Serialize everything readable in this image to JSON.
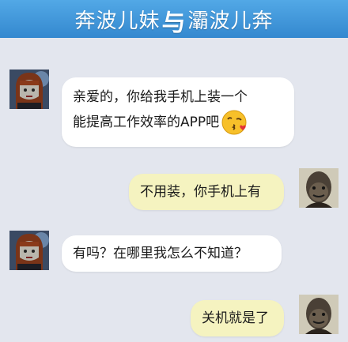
{
  "header": {
    "title_left": "奔波儿妹",
    "title_sep": "与",
    "title_right": "灞波儿奔"
  },
  "messages": [
    {
      "side": "left",
      "sender": "奔波儿妹",
      "lines": [
        "亲爱的，你给我手机上装一个",
        "能提高工作效率的APP吧"
      ],
      "emoji": "kissing-face-icon"
    },
    {
      "side": "right",
      "sender": "灞波儿奔",
      "lines": [
        "不用装，你手机上有"
      ]
    },
    {
      "side": "left",
      "sender": "奔波儿妹",
      "lines": [
        "有吗？在哪里我怎么不知道？"
      ]
    },
    {
      "side": "right",
      "sender": "灞波儿奔",
      "lines": [
        "关机就是了"
      ]
    }
  ],
  "colors": {
    "header_bg": "#3f95d8",
    "background": "#e3e6ee",
    "bubble_left": "#ffffff",
    "bubble_right": "#f5f3c0"
  }
}
